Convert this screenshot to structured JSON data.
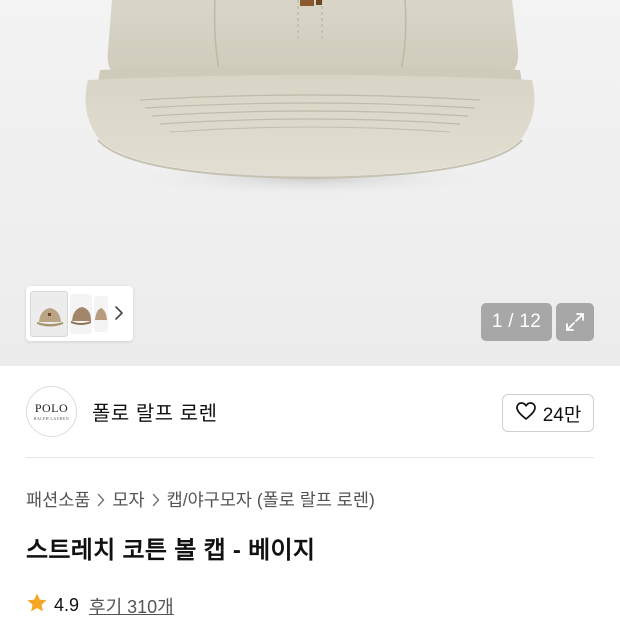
{
  "gallery": {
    "counter": "1 / 12",
    "expand_icon": "expand-icon",
    "thumbnail_next_icon": "chevron-right-icon"
  },
  "brand": {
    "logo_text": "POLO",
    "logo_subtext": "RALPH LAUREN",
    "name": "폴로 랄프 로렌",
    "like_icon": "heart-icon",
    "like_count": "24만"
  },
  "breadcrumb": {
    "items": [
      "패션소품",
      "모자",
      "캡/야구모자 (폴로 랄프 로렌)"
    ],
    "separator_icon": "chevron-right-icon"
  },
  "product": {
    "title": "스트레치 코튼 볼 캡 - 베이지",
    "rating_icon": "star-icon",
    "rating": "4.9",
    "reviews": "후기 310개"
  },
  "colors": {
    "cap": "#dcd9cb",
    "star": "#f5a623"
  }
}
